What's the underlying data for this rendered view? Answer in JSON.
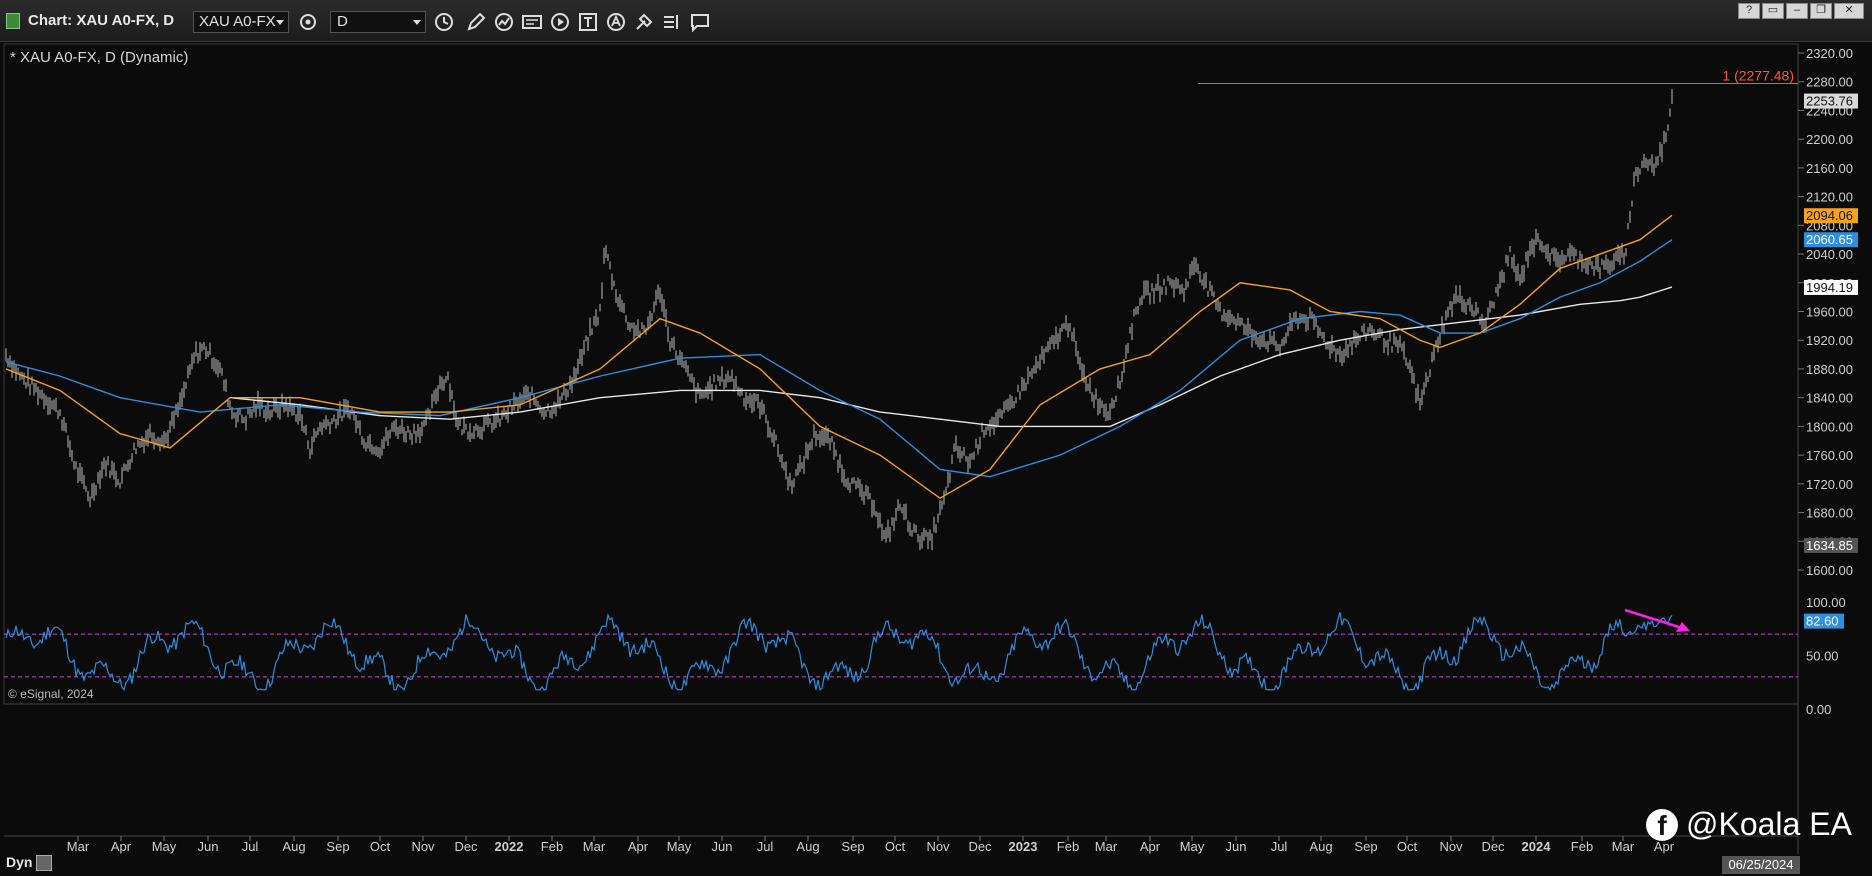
{
  "window": {
    "title": "Chart: XAU A0-FX, D",
    "symbol": "XAU A0-FX",
    "interval": "D",
    "controls": [
      "?",
      "min",
      "restore",
      "max",
      "close"
    ]
  },
  "toolbar_icons": [
    "settings-icon",
    "clock-icon",
    "pencil-icon",
    "chart-style-icon",
    "data-icon",
    "play-icon",
    "text-tool-icon",
    "alert-icon",
    "tools-icon",
    "layers-icon",
    "comment-icon"
  ],
  "chart": {
    "header": "* XAU A0-FX, D (Dynamic)",
    "copyright": "© eSignal, 2024",
    "hline_label": "1 (2277.48)",
    "hline_value": 2277.48,
    "price_labels": [
      {
        "text": "2253.76",
        "value": 2253.76,
        "bg": "#d9d9d9",
        "fg": "#111111"
      },
      {
        "text": "2094.06",
        "value": 2094.06,
        "bg": "#f7a21b",
        "fg": "#111111"
      },
      {
        "text": "2060.65",
        "value": 2060.65,
        "bg": "#2d8fe0",
        "fg": "#ffffff"
      },
      {
        "text": "1994.19",
        "value": 1994.19,
        "bg": "#ffffff",
        "fg": "#111111"
      },
      {
        "text": "1634.85",
        "value": 1634.85,
        "bg": "#555555",
        "fg": "#ffffff"
      }
    ],
    "y_axis": {
      "min": 1600,
      "max": 2320,
      "ticks": [
        "2320.00",
        "2280.00",
        "2240.00",
        "2200.00",
        "2160.00",
        "2120.00",
        "2080.00",
        "2040.00",
        "2000.00",
        "1960.00",
        "1920.00",
        "1880.00",
        "1840.00",
        "1800.00",
        "1760.00",
        "1720.00",
        "1680.00",
        "1640.00",
        "1600.00"
      ]
    },
    "colors": {
      "price": "#bdbdbd",
      "ma_orange": "#f7a21b",
      "ma_blue": "#2d8fe0",
      "ma_white": "#e8e8e8",
      "hline": "#ff5a1f"
    }
  },
  "oscillator": {
    "y_ticks": [
      "100.00",
      "50.00",
      "0.00"
    ],
    "value_label": "82.60",
    "value": 82.6,
    "upper_band": 70,
    "lower_band": 30,
    "colors": {
      "line": "#2d8fe0",
      "band": "#c94bd6",
      "arrow": "#ff22e6"
    }
  },
  "x_axis": {
    "labels": [
      "Mar",
      "Apr",
      "May",
      "Jun",
      "Jul",
      "Aug",
      "Sep",
      "Oct",
      "Nov",
      "Dec",
      "2022",
      "Feb",
      "Mar",
      "Apr",
      "May",
      "Jun",
      "Jul",
      "Aug",
      "Sep",
      "Oct",
      "Nov",
      "Dec",
      "2023",
      "Feb",
      "Mar",
      "Apr",
      "May",
      "Jun",
      "Jul",
      "Aug",
      "Sep",
      "Oct",
      "Nov",
      "Dec",
      "2024",
      "Feb",
      "Mar",
      "Apr"
    ],
    "positions": [
      78,
      121,
      164,
      208,
      250,
      294,
      338,
      380,
      423,
      466,
      509,
      552,
      594,
      638,
      679,
      722,
      765,
      808,
      853,
      895,
      938,
      980,
      1023,
      1068,
      1106,
      1150,
      1192,
      1236,
      1279,
      1321,
      1366,
      1407,
      1451,
      1493,
      1536,
      1582,
      1623,
      1664
    ]
  },
  "footer": {
    "dyn_label": "Dyn",
    "date": "06/25/2024",
    "watermark": "@Koala EA"
  }
}
